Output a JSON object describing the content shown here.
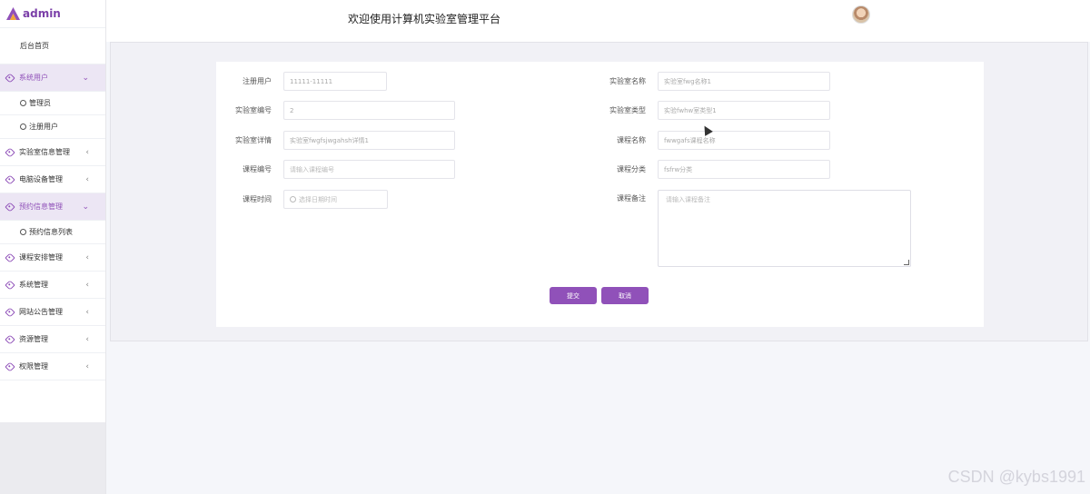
{
  "app": {
    "logo_text": "admin"
  },
  "header": {
    "title": "欢迎使用计算机实验室管理平台"
  },
  "sidebar": {
    "home": "后台首页",
    "menus": [
      {
        "label": "系统用户",
        "arrow": "⌄",
        "children": [
          "管理员",
          "注册用户"
        ]
      },
      {
        "label": "实验室信息管理",
        "arrow": "‹"
      },
      {
        "label": "电脑设备管理",
        "arrow": "‹"
      },
      {
        "label": "预约信息管理",
        "arrow": "⌄",
        "children": [
          "预约信息列表"
        ]
      },
      {
        "label": "课程安排管理",
        "arrow": "‹"
      },
      {
        "label": "系统管理",
        "arrow": "‹"
      },
      {
        "label": "网站公告管理",
        "arrow": "‹"
      },
      {
        "label": "资源管理",
        "arrow": "‹"
      },
      {
        "label": "权限管理",
        "arrow": "‹"
      }
    ]
  },
  "form": {
    "fields": {
      "register_user": {
        "label": "注册用户",
        "value": "11111-11111"
      },
      "lab_name": {
        "label": "实验室名称",
        "value": "实验室fwg名称1"
      },
      "lab_no": {
        "label": "实验室编号",
        "value": "2"
      },
      "lab_type": {
        "label": "实验室类型",
        "value": "实验fwhw室类型1"
      },
      "lab_detail": {
        "label": "实验室详情",
        "value": "实验室fwgfsjwgahsh详情1"
      },
      "course_name": {
        "label": "课程名称",
        "value": "fwwgafs课程名称"
      },
      "course_no": {
        "label": "课程编号",
        "placeholder": "请输入课程编号"
      },
      "course_category": {
        "label": "课程分类",
        "value": "fsfrw分类"
      },
      "course_time": {
        "label": "课程时间",
        "placeholder": "选择日期时间"
      },
      "course_remark": {
        "label": "课程备注",
        "placeholder": "请输入课程备注"
      }
    },
    "submit_label": "提交",
    "cancel_label": "取消"
  },
  "watermark": "CSDN @kybs1991",
  "colors": {
    "accent": "#9051b9",
    "active_bg": "#ece6f4"
  }
}
